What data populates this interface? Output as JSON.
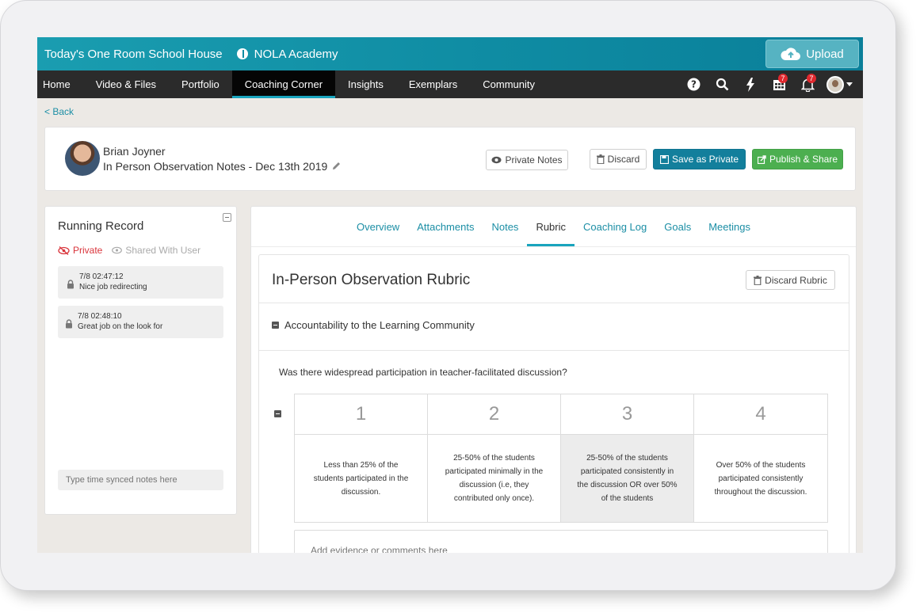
{
  "topbar": {
    "brand": "Today's One Room School House",
    "org": "NOLA Academy",
    "upload_label": "Upload"
  },
  "nav": {
    "items": [
      "Home",
      "Video & Files",
      "Portfolio",
      "Coaching Corner",
      "Insights",
      "Exemplars",
      "Community"
    ],
    "active": "Coaching Corner",
    "calendar_badge": "7",
    "bell_badge": "7"
  },
  "back_label": "< Back",
  "header": {
    "user_name": "Brian Joyner",
    "note_title": "In Person Observation Notes - Dec 13th 2019",
    "private_notes_label": "Private Notes",
    "discard_label": "Discard",
    "save_private_label": "Save as Private",
    "publish_label": "Publish & Share"
  },
  "running_record": {
    "title": "Running Record",
    "private_label": "Private",
    "shared_label": "Shared With User",
    "notes": [
      {
        "time": "7/8  02:47:12",
        "text": "Nice job redirecting"
      },
      {
        "time": "7/8  02:48:10",
        "text": "Great job on the look for"
      }
    ],
    "input_placeholder": "Type time synced notes here"
  },
  "tabs": [
    "Overview",
    "Attachments",
    "Notes",
    "Rubric",
    "Coaching Log",
    "Goals",
    "Meetings"
  ],
  "active_tab": "Rubric",
  "rubric": {
    "title": "In-Person Observation Rubric",
    "discard_label": "Discard Rubric",
    "section": "Accountability to the Learning Community",
    "question": "Was there widespread participation in teacher-facilitated discussion?",
    "levels": [
      {
        "score": "1",
        "desc": "Less than 25% of the students participated in the discussion."
      },
      {
        "score": "2",
        "desc": "25-50% of the students participated minimally in the discussion (i.e, they contributed only once)."
      },
      {
        "score": "3",
        "desc": "25-50% of the students participated consistently in the discussion OR over 50% of the students"
      },
      {
        "score": "4",
        "desc": "Over 50% of the students participated consistently throughout the discussion."
      }
    ],
    "selected_level": "3",
    "evidence_placeholder": "Add evidence or comments here"
  },
  "colors": {
    "accent": "#19a4bd",
    "teal_button": "#137f9c",
    "green_button": "#4caf50",
    "private_red": "#d9343b",
    "nav_bg": "#2b2b2b"
  }
}
